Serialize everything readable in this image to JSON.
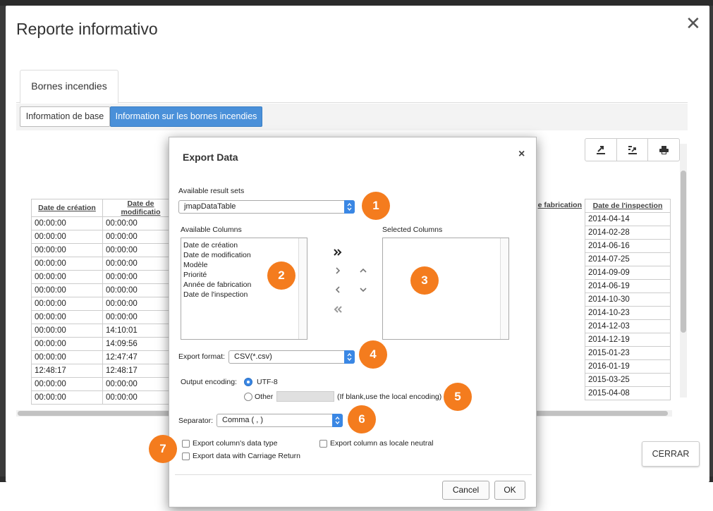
{
  "main": {
    "title": "Reporte informativo",
    "close_glyph": "✕",
    "tab_label": "Bornes incendies",
    "subtabs": [
      "Information de base",
      "Information sur les bornes incendies"
    ],
    "close_button_label": "CERRAR"
  },
  "table": {
    "headers_left": [
      "Date de création",
      "Date de modificatio"
    ],
    "header_fabrication": "e fabrication",
    "header_inspection": "Date de l'inspection",
    "rows": [
      [
        "00:00:00",
        "00:00:00",
        "2014-04-14"
      ],
      [
        "00:00:00",
        "00:00:00",
        "2014-02-28"
      ],
      [
        "00:00:00",
        "00:00:00",
        "2014-06-16"
      ],
      [
        "00:00:00",
        "00:00:00",
        "2014-07-25"
      ],
      [
        "00:00:00",
        "00:00:00",
        "2014-09-09"
      ],
      [
        "00:00:00",
        "00:00:00",
        "2014-06-19"
      ],
      [
        "00:00:00",
        "00:00:00",
        "2014-10-30"
      ],
      [
        "00:00:00",
        "00:00:00",
        "2014-10-23"
      ],
      [
        "00:00:00",
        "14:10:01",
        "2014-12-03"
      ],
      [
        "00:00:00",
        "14:09:56",
        "2014-12-19"
      ],
      [
        "00:00:00",
        "12:47:47",
        "2015-01-23"
      ],
      [
        "12:48:17",
        "12:48:17",
        "2016-01-19"
      ],
      [
        "00:00:00",
        "00:00:00",
        "2015-03-25"
      ],
      [
        "00:00:00",
        "00:00:00",
        "2015-04-08"
      ]
    ]
  },
  "toolbar": {
    "icons": [
      "export-icon",
      "export-selection-icon",
      "print-icon"
    ]
  },
  "export": {
    "title": "Export Data",
    "close_glyph": "×",
    "result_sets_label": "Available result sets",
    "result_set_value": "jmapDataTable",
    "available_columns_label": "Available Columns",
    "selected_columns_label": "Selected Columns",
    "available_columns": [
      "Date de création",
      "Date de modification",
      "Modèle",
      "Priorité",
      "Année de fabrication",
      "Date de l'inspection"
    ],
    "format_label": "Export format:",
    "format_value": "CSV(*.csv)",
    "encoding_label": "Output encoding:",
    "encoding_utf8": "UTF-8",
    "encoding_other": "Other",
    "encoding_hint": "(If blank,use the local encoding)",
    "separator_label": "Separator:",
    "separator_value": "Comma ( , )",
    "opt_data_type": "Export column's data type",
    "opt_locale_neutral": "Export column as locale neutral",
    "opt_carriage_return": "Export data with Carriage Return",
    "cancel_label": "Cancel",
    "ok_label": "OK",
    "accent_color": "#3a87e4"
  },
  "badges": [
    "1",
    "2",
    "3",
    "4",
    "5",
    "6",
    "7"
  ],
  "badge_color": "#f47c1e"
}
